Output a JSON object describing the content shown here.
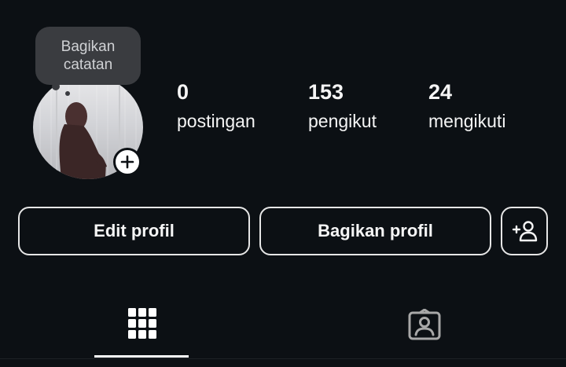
{
  "profile": {
    "note_text_line1": "Bagikan",
    "note_text_line2": "catatan",
    "add_icon": "plus-icon"
  },
  "stats": [
    {
      "value": "0",
      "label": "postingan"
    },
    {
      "value": "153",
      "label": "pengikut"
    },
    {
      "value": "24",
      "label": "mengikuti"
    }
  ],
  "actions": {
    "edit_label": "Edit profil",
    "share_label": "Bagikan profil",
    "discover_icon": "add-person-icon"
  },
  "tabs": [
    {
      "icon": "grid-icon",
      "active": true
    },
    {
      "icon": "tagged-person-icon",
      "active": false
    }
  ],
  "colors": {
    "background": "#0c1014",
    "text": "#f5f5f5",
    "button_border": "#e6e6e6",
    "bubble": "#3a3c40",
    "tab_inactive": "#a8a8a8"
  }
}
